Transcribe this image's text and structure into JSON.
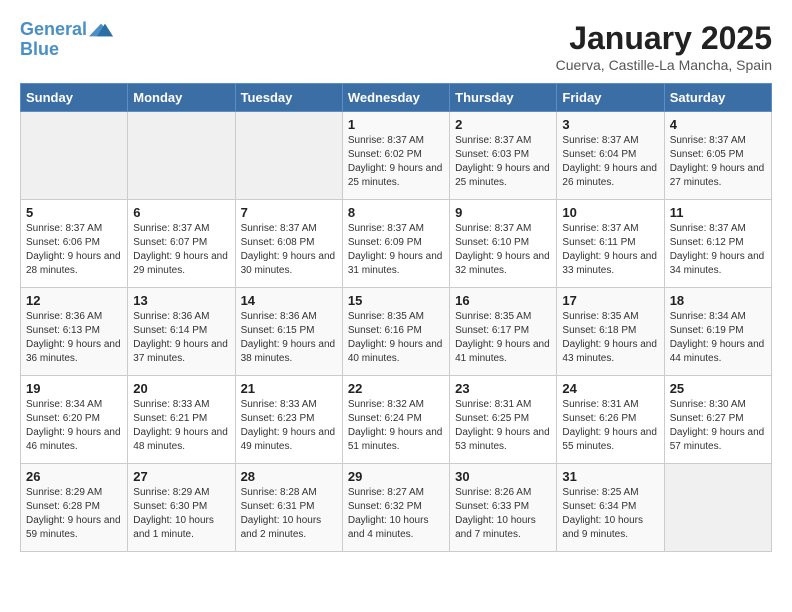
{
  "header": {
    "logo_line1": "General",
    "logo_line2": "Blue",
    "month": "January 2025",
    "location": "Cuerva, Castille-La Mancha, Spain"
  },
  "weekdays": [
    "Sunday",
    "Monday",
    "Tuesday",
    "Wednesday",
    "Thursday",
    "Friday",
    "Saturday"
  ],
  "weeks": [
    [
      {
        "day": "",
        "empty": true
      },
      {
        "day": "",
        "empty": true
      },
      {
        "day": "",
        "empty": true
      },
      {
        "day": "1",
        "sunrise": "8:37 AM",
        "sunset": "6:02 PM",
        "daylight": "9 hours and 25 minutes."
      },
      {
        "day": "2",
        "sunrise": "8:37 AM",
        "sunset": "6:03 PM",
        "daylight": "9 hours and 25 minutes."
      },
      {
        "day": "3",
        "sunrise": "8:37 AM",
        "sunset": "6:04 PM",
        "daylight": "9 hours and 26 minutes."
      },
      {
        "day": "4",
        "sunrise": "8:37 AM",
        "sunset": "6:05 PM",
        "daylight": "9 hours and 27 minutes."
      }
    ],
    [
      {
        "day": "5",
        "sunrise": "8:37 AM",
        "sunset": "6:06 PM",
        "daylight": "9 hours and 28 minutes."
      },
      {
        "day": "6",
        "sunrise": "8:37 AM",
        "sunset": "6:07 PM",
        "daylight": "9 hours and 29 minutes."
      },
      {
        "day": "7",
        "sunrise": "8:37 AM",
        "sunset": "6:08 PM",
        "daylight": "9 hours and 30 minutes."
      },
      {
        "day": "8",
        "sunrise": "8:37 AM",
        "sunset": "6:09 PM",
        "daylight": "9 hours and 31 minutes."
      },
      {
        "day": "9",
        "sunrise": "8:37 AM",
        "sunset": "6:10 PM",
        "daylight": "9 hours and 32 minutes."
      },
      {
        "day": "10",
        "sunrise": "8:37 AM",
        "sunset": "6:11 PM",
        "daylight": "9 hours and 33 minutes."
      },
      {
        "day": "11",
        "sunrise": "8:37 AM",
        "sunset": "6:12 PM",
        "daylight": "9 hours and 34 minutes."
      }
    ],
    [
      {
        "day": "12",
        "sunrise": "8:36 AM",
        "sunset": "6:13 PM",
        "daylight": "9 hours and 36 minutes."
      },
      {
        "day": "13",
        "sunrise": "8:36 AM",
        "sunset": "6:14 PM",
        "daylight": "9 hours and 37 minutes."
      },
      {
        "day": "14",
        "sunrise": "8:36 AM",
        "sunset": "6:15 PM",
        "daylight": "9 hours and 38 minutes."
      },
      {
        "day": "15",
        "sunrise": "8:35 AM",
        "sunset": "6:16 PM",
        "daylight": "9 hours and 40 minutes."
      },
      {
        "day": "16",
        "sunrise": "8:35 AM",
        "sunset": "6:17 PM",
        "daylight": "9 hours and 41 minutes."
      },
      {
        "day": "17",
        "sunrise": "8:35 AM",
        "sunset": "6:18 PM",
        "daylight": "9 hours and 43 minutes."
      },
      {
        "day": "18",
        "sunrise": "8:34 AM",
        "sunset": "6:19 PM",
        "daylight": "9 hours and 44 minutes."
      }
    ],
    [
      {
        "day": "19",
        "sunrise": "8:34 AM",
        "sunset": "6:20 PM",
        "daylight": "9 hours and 46 minutes."
      },
      {
        "day": "20",
        "sunrise": "8:33 AM",
        "sunset": "6:21 PM",
        "daylight": "9 hours and 48 minutes."
      },
      {
        "day": "21",
        "sunrise": "8:33 AM",
        "sunset": "6:23 PM",
        "daylight": "9 hours and 49 minutes."
      },
      {
        "day": "22",
        "sunrise": "8:32 AM",
        "sunset": "6:24 PM",
        "daylight": "9 hours and 51 minutes."
      },
      {
        "day": "23",
        "sunrise": "8:31 AM",
        "sunset": "6:25 PM",
        "daylight": "9 hours and 53 minutes."
      },
      {
        "day": "24",
        "sunrise": "8:31 AM",
        "sunset": "6:26 PM",
        "daylight": "9 hours and 55 minutes."
      },
      {
        "day": "25",
        "sunrise": "8:30 AM",
        "sunset": "6:27 PM",
        "daylight": "9 hours and 57 minutes."
      }
    ],
    [
      {
        "day": "26",
        "sunrise": "8:29 AM",
        "sunset": "6:28 PM",
        "daylight": "9 hours and 59 minutes."
      },
      {
        "day": "27",
        "sunrise": "8:29 AM",
        "sunset": "6:30 PM",
        "daylight": "10 hours and 1 minute."
      },
      {
        "day": "28",
        "sunrise": "8:28 AM",
        "sunset": "6:31 PM",
        "daylight": "10 hours and 2 minutes."
      },
      {
        "day": "29",
        "sunrise": "8:27 AM",
        "sunset": "6:32 PM",
        "daylight": "10 hours and 4 minutes."
      },
      {
        "day": "30",
        "sunrise": "8:26 AM",
        "sunset": "6:33 PM",
        "daylight": "10 hours and 7 minutes."
      },
      {
        "day": "31",
        "sunrise": "8:25 AM",
        "sunset": "6:34 PM",
        "daylight": "10 hours and 9 minutes."
      },
      {
        "day": "",
        "empty": true
      }
    ]
  ],
  "labels": {
    "sunrise": "Sunrise:",
    "sunset": "Sunset:",
    "daylight": "Daylight:"
  }
}
